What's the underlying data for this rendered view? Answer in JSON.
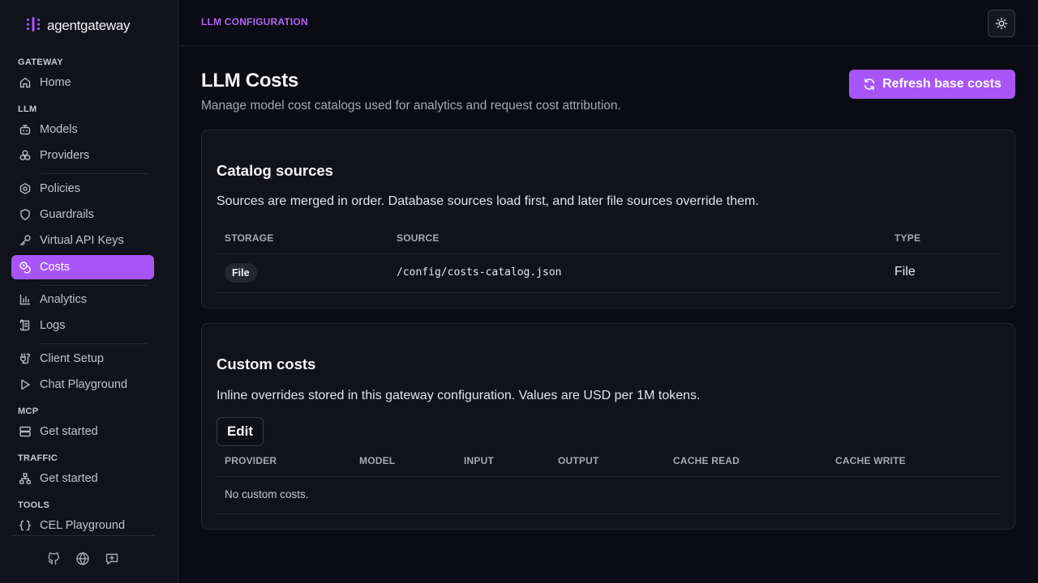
{
  "brand": {
    "name": "agentgateway"
  },
  "sidebar": {
    "sections": {
      "gateway": "GATEWAY",
      "llm": "LLM",
      "mcp": "MCP",
      "traffic": "TRAFFIC",
      "tools": "TOOLS"
    },
    "items": {
      "home": "Home",
      "models": "Models",
      "providers": "Providers",
      "policies": "Policies",
      "guardrails": "Guardrails",
      "virtual_keys": "Virtual API Keys",
      "costs": "Costs",
      "analytics": "Analytics",
      "logs": "Logs",
      "client_setup": "Client Setup",
      "chat_playground": "Chat Playground",
      "mcp_get_started": "Get started",
      "traffic_get_started": "Get started",
      "cel_playground": "CEL Playground"
    },
    "active": "costs",
    "footer_icons": [
      "github-icon",
      "globe-icon",
      "feedback-icon"
    ]
  },
  "header": {
    "breadcrumb": "LLM CONFIGURATION"
  },
  "page": {
    "title": "LLM Costs",
    "subtitle": "Manage model cost catalogs used for analytics and request cost attribution.",
    "refresh_label": "Refresh base costs"
  },
  "catalog": {
    "title": "Catalog sources",
    "description": "Sources are merged in order. Database sources load first, and later file sources override them.",
    "columns": {
      "storage": "STORAGE",
      "source": "SOURCE",
      "type": "TYPE"
    },
    "rows": [
      {
        "storage": "File",
        "source": "/config/costs-catalog.json",
        "type": "File"
      }
    ]
  },
  "custom": {
    "title": "Custom costs",
    "description": "Inline overrides stored in this gateway configuration. Values are USD per 1M tokens.",
    "edit_label": "Edit",
    "columns": {
      "provider": "PROVIDER",
      "model": "MODEL",
      "input": "INPUT",
      "output": "OUTPUT",
      "cache_read": "CACHE READ",
      "cache_write": "CACHE WRITE"
    },
    "empty_text": "No custom costs."
  },
  "colors": {
    "accent": "#a855f7",
    "background": "#0a0b14",
    "sidebar": "#11121b"
  }
}
